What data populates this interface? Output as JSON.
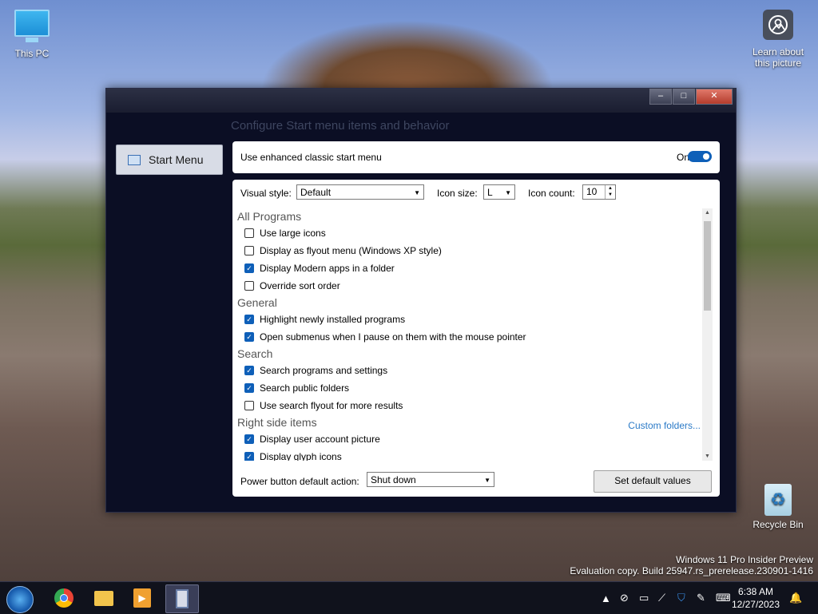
{
  "desktop": {
    "this_pc": "This PC",
    "learn": "Learn about this picture",
    "recycle_bin": "Recycle Bin",
    "watermark_line1": "Windows 11 Pro Insider Preview",
    "watermark_line2": "Evaluation copy. Build 25947.rs_prerelease.230901-1416"
  },
  "window": {
    "heading": "Configure Start menu items and behavior",
    "controls": {
      "minimize": "–",
      "maximize": "□",
      "close": "✕"
    },
    "nav": {
      "start_menu": "Start Menu"
    },
    "enhanced": {
      "label": "Use enhanced classic start menu",
      "state": "On"
    },
    "visual_style": {
      "label": "Visual style:",
      "value": "Default"
    },
    "icon_size": {
      "label": "Icon size:",
      "value": "L"
    },
    "icon_count": {
      "label": "Icon count:",
      "value": "10"
    },
    "groups": {
      "all_programs": "All Programs",
      "general": "General",
      "search": "Search",
      "right_side": "Right side items"
    },
    "options": {
      "large_icons": "Use large icons",
      "flyout": "Display as flyout menu (Windows XP style)",
      "modern_apps": "Display Modern apps in a folder",
      "sort": "Override sort order",
      "highlight": "Highlight newly installed programs",
      "submenus": "Open submenus when I pause on them with the mouse pointer",
      "search_programs": "Search programs and settings",
      "search_public": "Search public folders",
      "search_flyout": "Use search flyout for more results",
      "user_picture": "Display user account picture",
      "glyph_icons": "Display glyph icons"
    },
    "custom_folders": "Custom folders...",
    "power": {
      "label": "Power button default action:",
      "value": "Shut down"
    },
    "set_default": "Set default values"
  },
  "taskbar": {
    "time": "6:38 AM",
    "date": "12/27/2023"
  }
}
